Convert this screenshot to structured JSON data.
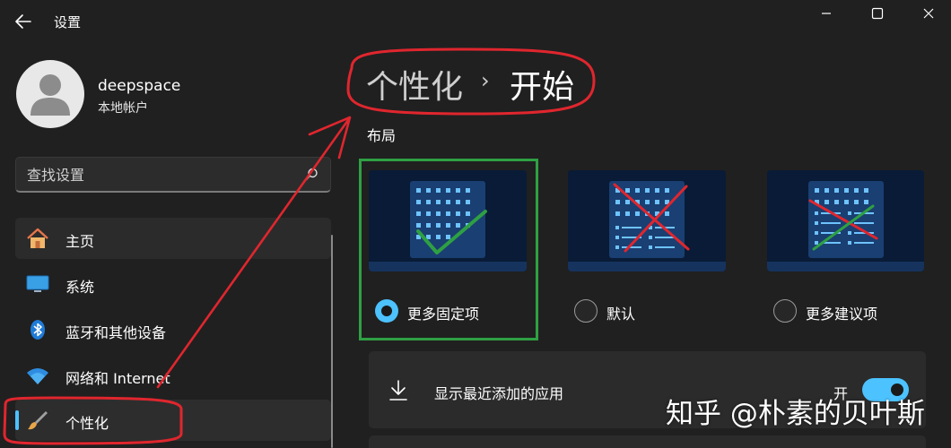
{
  "window": {
    "title": "设置"
  },
  "user": {
    "name": "deepspace",
    "account_type": "本地帐户"
  },
  "search": {
    "placeholder": "查找设置"
  },
  "nav": {
    "items": [
      {
        "label": "主页",
        "icon": "home-icon"
      },
      {
        "label": "系统",
        "icon": "monitor-icon"
      },
      {
        "label": "蓝牙和其他设备",
        "icon": "bluetooth-icon"
      },
      {
        "label": "网络和 Internet",
        "icon": "wifi-icon"
      },
      {
        "label": "个性化",
        "icon": "brush-icon",
        "selected": true
      }
    ]
  },
  "breadcrumb": {
    "parent": "个性化",
    "separator": "›",
    "current": "开始"
  },
  "layout_section": {
    "title": "布局",
    "options": [
      {
        "label": "更多固定项",
        "selected": true
      },
      {
        "label": "默认",
        "selected": false
      },
      {
        "label": "更多建议项",
        "selected": false
      }
    ]
  },
  "recent_apps": {
    "label": "显示最近添加的应用",
    "state": "开",
    "on": true
  },
  "watermark": "知乎 @朴素的贝叶斯",
  "colors": {
    "accent": "#4cc2ff",
    "annotation_red": "#e0262e",
    "annotation_green": "#2ea043",
    "background": "#202020"
  }
}
